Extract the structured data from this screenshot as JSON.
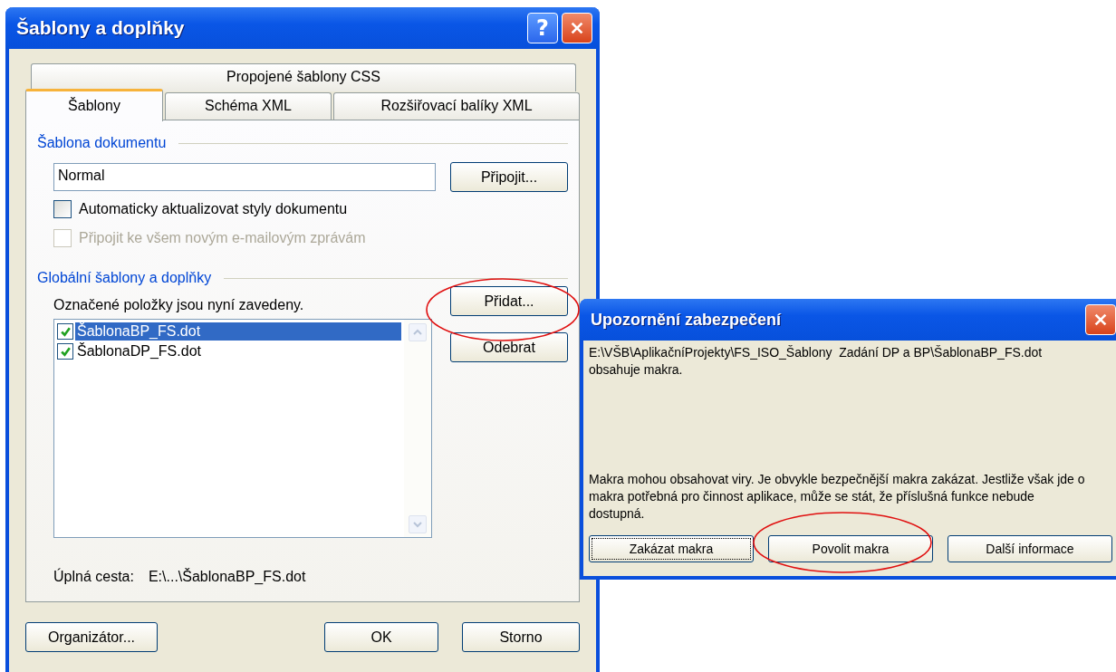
{
  "window": {
    "title": "Šablony a doplňky",
    "help_label": "?"
  },
  "back_tabs": [
    {
      "label": "Propojené šablony CSS",
      "selected": false
    }
  ],
  "tabs": [
    {
      "label": "Šablony",
      "selected": true
    },
    {
      "label": "Schéma XML",
      "selected": false
    },
    {
      "label": "Rozšiřovací balíky XML",
      "selected": false
    }
  ],
  "document_template": {
    "heading": "Šablona dokumentu",
    "value": "Normal",
    "attach_button": "Připojit...",
    "options": [
      {
        "label": "Automaticky aktualizovat styly dokumentu",
        "checked": false,
        "disabled": false
      },
      {
        "label": "Připojit ke všem novým e-mailovým zprávám",
        "checked": false,
        "disabled": true
      }
    ]
  },
  "global_templates": {
    "heading": "Globální šablony a doplňky",
    "caption": "Označené položky jsou nyní zavedeny.",
    "add_button": "Přidat...",
    "remove_button": "Odebrat",
    "items": [
      {
        "label": "ŠablonaBP_FS.dot",
        "checked": true,
        "selected": true
      },
      {
        "label": "ŠablonaDP_FS.dot",
        "checked": true,
        "selected": false
      }
    ],
    "path_label": "Úplná cesta:",
    "path_value": "E:\\...\\ŠablonaBP_FS.dot"
  },
  "buttons": [
    {
      "label": "Organizátor..."
    },
    {
      "label": "OK"
    },
    {
      "label": "Storno"
    }
  ],
  "security_dialog": {
    "title": "Upozornění zabezpečení",
    "message": "E:\\VŠB\\AplikačníProjekty\\FS_ISO_Šablony  Zadání DP a BP\\ŠablonaBP_FS.dot obsahuje makra.",
    "warning": "Makra mohou obsahovat viry. Je obvykle bezpečnější makra zakázat. Jestliže však jde o makra potřebná pro činnost aplikace, může se stát, že příslušná funkce nebude dostupná.",
    "buttons": [
      {
        "label": "Zakázat makra",
        "selected": true
      },
      {
        "label": "Povolit makra",
        "selected": false
      },
      {
        "label": "Další informace",
        "selected": false
      }
    ]
  }
}
